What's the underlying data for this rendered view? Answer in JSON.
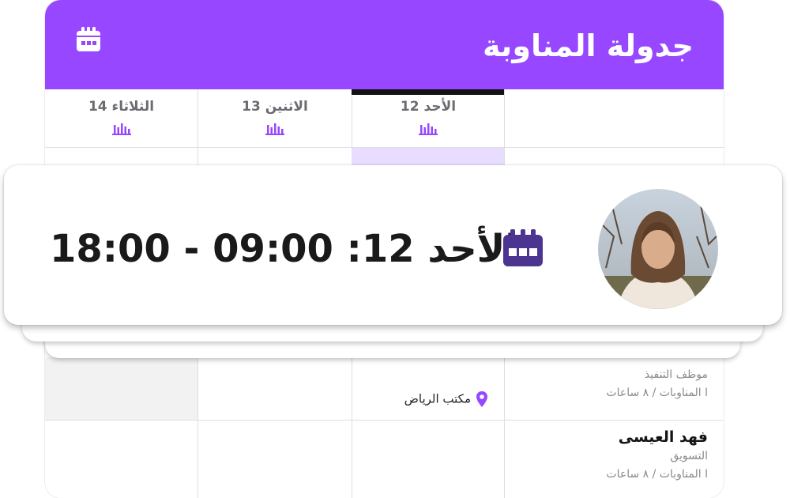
{
  "schedule": {
    "title": "جدولة المناوبة",
    "days": [
      {
        "label": "الأحد 12",
        "active": true
      },
      {
        "label": "الاثنين 13",
        "active": false
      },
      {
        "label": "الثلاثاء 14",
        "active": false
      }
    ],
    "employees": [
      {
        "name": "",
        "role": "موظف التنفيذ",
        "summary": "ا المناوبات / ٨ ساعات",
        "shift_location": "مكتب الرياض"
      },
      {
        "name": "فهد العيسى",
        "role": "التسويق",
        "summary": "ا المناوبات / ٨ ساعات"
      }
    ]
  },
  "shift_card": {
    "text": "الأحد 12: 09:00 - 18:00"
  },
  "colors": {
    "header": "#9747ff",
    "calendar_icon": "#4b3590",
    "active_cell": "#e8dcff"
  },
  "icons": [
    "calendar-icon",
    "bar-chart-icon",
    "location-pin-icon"
  ]
}
